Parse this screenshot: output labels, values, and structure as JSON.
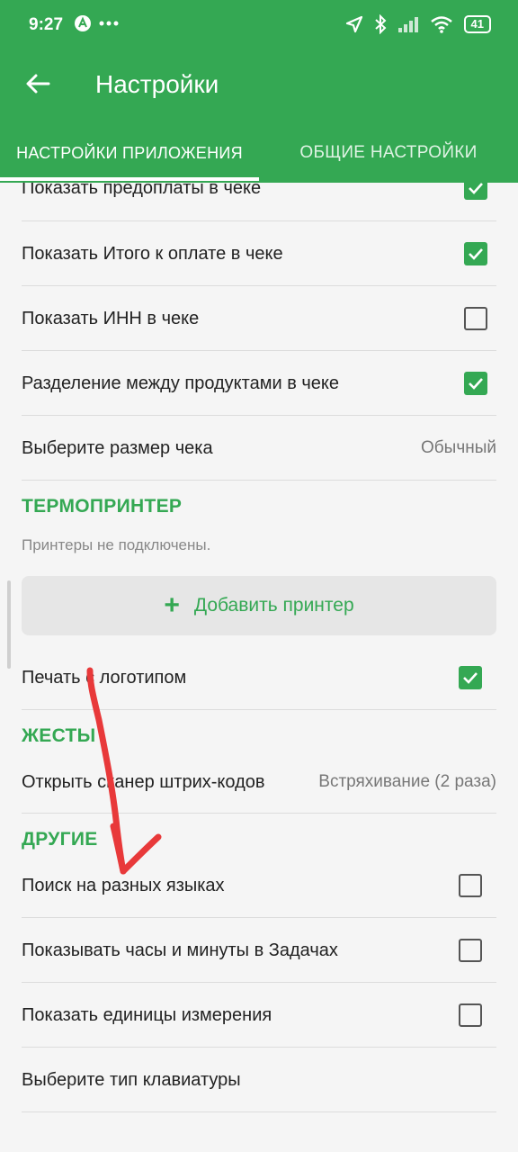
{
  "status_bar": {
    "time": "9:27",
    "battery": "41"
  },
  "toolbar": {
    "title": "Настройки"
  },
  "tabs": [
    {
      "label": "НАСТРОЙКИ ПРИЛОЖЕНИЯ",
      "active": true
    },
    {
      "label": "ОБЩИЕ НАСТРОЙКИ",
      "active": false
    }
  ],
  "settings": {
    "receipt": [
      {
        "label": "Показать предоплаты в чеке",
        "checked": true
      },
      {
        "label": "Показать Итого к оплате в чеке",
        "checked": true
      },
      {
        "label": "Показать ИНН в чеке",
        "checked": false
      },
      {
        "label": "Разделение между продуктами в чеке",
        "checked": true
      }
    ],
    "receipt_size": {
      "label": "Выберите размер чека",
      "value": "Обычный"
    },
    "thermoprinter": {
      "title": "ТЕРМОПРИНТЕР",
      "hint": "Принтеры не подключены.",
      "add_button": "Добавить принтер",
      "logo": {
        "label": "Печать с логотипом",
        "checked": true
      }
    },
    "gestures": {
      "title": "ЖЕСТЫ",
      "scanner": {
        "label": "Открыть сканер штрих-кодов",
        "value": "Встряхивание (2 раза)"
      }
    },
    "other": {
      "title": "ДРУГИЕ",
      "items": [
        {
          "label": "Поиск на разных языках",
          "checked": false
        },
        {
          "label": "Показывать часы и минуты в Задачах",
          "checked": false
        },
        {
          "label": "Показать единицы измерения",
          "checked": false
        }
      ],
      "keyboard": {
        "label": "Выберите тип клавиатуры"
      }
    }
  },
  "colors": {
    "accent": "#34a853",
    "annotation": "#e8393a"
  }
}
